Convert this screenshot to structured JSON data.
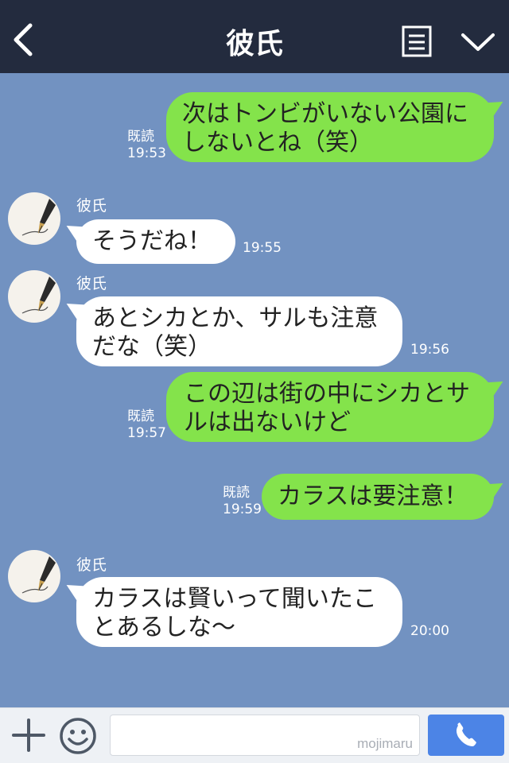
{
  "header": {
    "title": "彼氏",
    "back_icon": "chevron-left-icon",
    "menu_icon": "notes-icon",
    "expand_icon": "chevron-down-icon"
  },
  "messages": [
    {
      "side": "me",
      "text": "次はトンビがいない公園に\nしないとね（笑）",
      "read": "既読",
      "time": "19:53"
    },
    {
      "side": "them",
      "sender": "彼氏",
      "text": "そうだね！",
      "time": "19:55"
    },
    {
      "side": "them",
      "sender": "彼氏",
      "text": "あとシカとか、サルも注意\nだな（笑）",
      "time": "19:56"
    },
    {
      "side": "me",
      "text": "この辺は街の中にシカとサ\nルは出ないけど",
      "read": "既読",
      "time": "19:57"
    },
    {
      "side": "me",
      "text": "カラスは要注意！",
      "read": "既読",
      "time": "19:59"
    },
    {
      "side": "them",
      "sender": "彼氏",
      "text": "カラスは賢いって聞いたこ\nとあるしな〜",
      "time": "20:00"
    }
  ],
  "footer": {
    "plus_icon": "plus-icon",
    "emoji_icon": "smiley-icon",
    "watermark": "mojimaru",
    "call_icon": "phone-icon"
  },
  "colors": {
    "background": "#7292c1",
    "header": "#232b3e",
    "my_bubble": "#84e34b",
    "their_bubble": "#ffffff",
    "call_button": "#4c84e6"
  }
}
